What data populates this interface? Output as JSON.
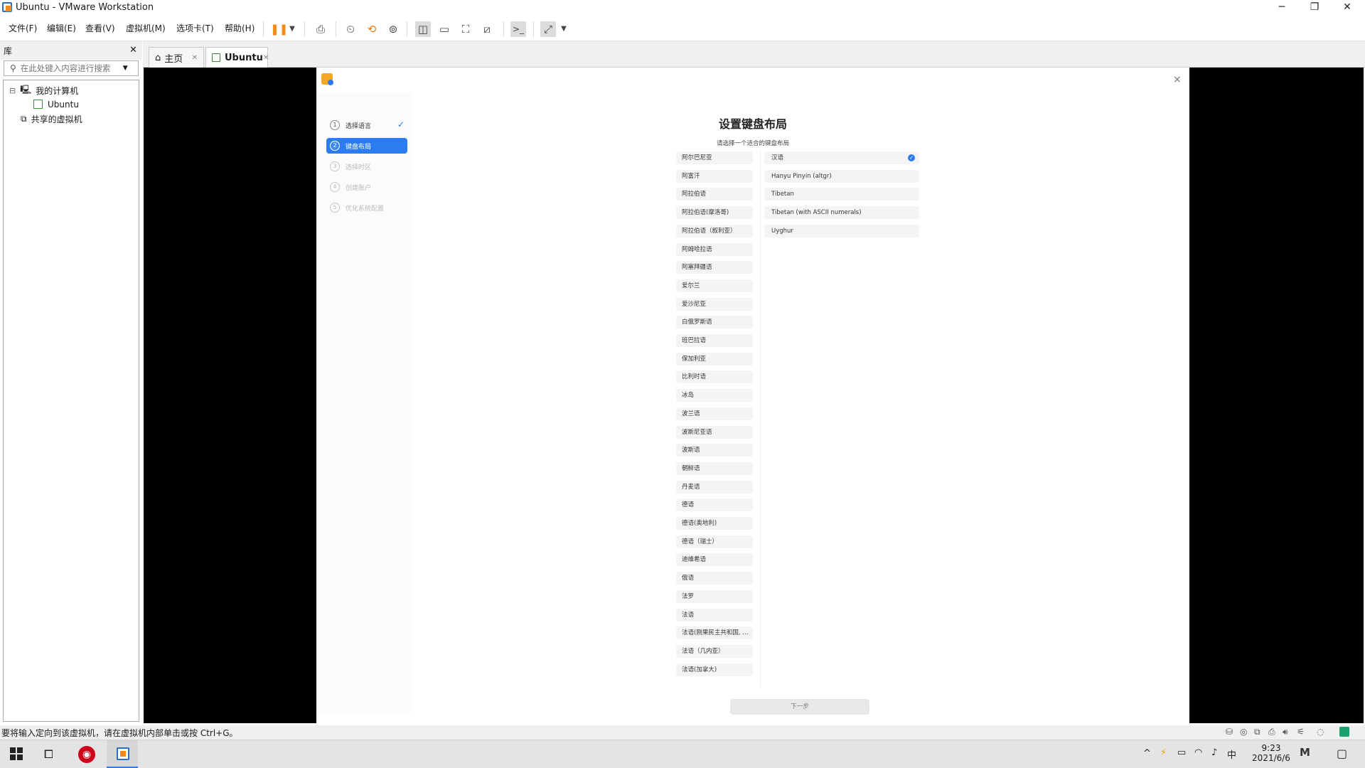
{
  "window": {
    "title": "Ubuntu - VMware Workstation",
    "minimize": "─",
    "maximize": "❐",
    "close": "✕"
  },
  "menu": [
    "文件(F)",
    "编辑(E)",
    "查看(V)",
    "虚拟机(M)",
    "选项卡(T)",
    "帮助(H)"
  ],
  "library": {
    "title": "库",
    "close": "✕",
    "search_placeholder": "在此处键入内容进行搜索",
    "tree": {
      "my_computer": "我的计算机",
      "vm": "Ubuntu",
      "shared": "共享的虚拟机",
      "expander": "⊟"
    }
  },
  "tabs": [
    {
      "label": "主页",
      "close": "✕"
    },
    {
      "label": "Ubuntu",
      "close": "✕"
    }
  ],
  "installer": {
    "close": "×",
    "title": "设置键盘布局",
    "subtitle": "请选择一个适合的键盘布局",
    "next_button": "下一步",
    "steps": [
      {
        "num": "1",
        "label": "选择语言"
      },
      {
        "num": "2",
        "label": "键盘布局"
      },
      {
        "num": "3",
        "label": "选择时区"
      },
      {
        "num": "4",
        "label": "创建账户"
      },
      {
        "num": "5",
        "label": "优化系统配置"
      }
    ],
    "languages": [
      "阿尔巴尼亚",
      "阿富汗",
      "阿拉伯语",
      "阿拉伯语(摩洛哥)",
      "阿拉伯语（叙利亚）",
      "阿姆哈拉语",
      "阿塞拜疆语",
      "爱尔兰",
      "爱沙尼亚",
      "白俄罗斯语",
      "班巴拉语",
      "保加利亚",
      "比利时语",
      "冰岛",
      "波兰语",
      "波斯尼亚语",
      "波斯语",
      "朝鲜语",
      "丹麦语",
      "德语",
      "德语(奥地利)",
      "德语（瑞士）",
      "迪维希语",
      "俄语",
      "法罗",
      "法语",
      "法语(刚果民主共和国, …",
      "法语（几内亚）",
      "法语(加拿大)"
    ],
    "layouts": [
      "汉语",
      "Hanyu Pinyin (altgr)",
      "Tibetan",
      "Tibetan (with ASCII numerals)",
      "Uyghur"
    ]
  },
  "status": {
    "message": "要将输入定向到该虚拟机，请在虚拟机内部单击或按 Ctrl+G。"
  },
  "taskbar": {
    "time": "9:23",
    "date": "2021/6/6",
    "ime": "中",
    "tray_up": "^"
  },
  "colors": {
    "accent": "#2b7cf0",
    "vmware_orange": "#f28a1c",
    "netease_red": "#d0021b"
  }
}
